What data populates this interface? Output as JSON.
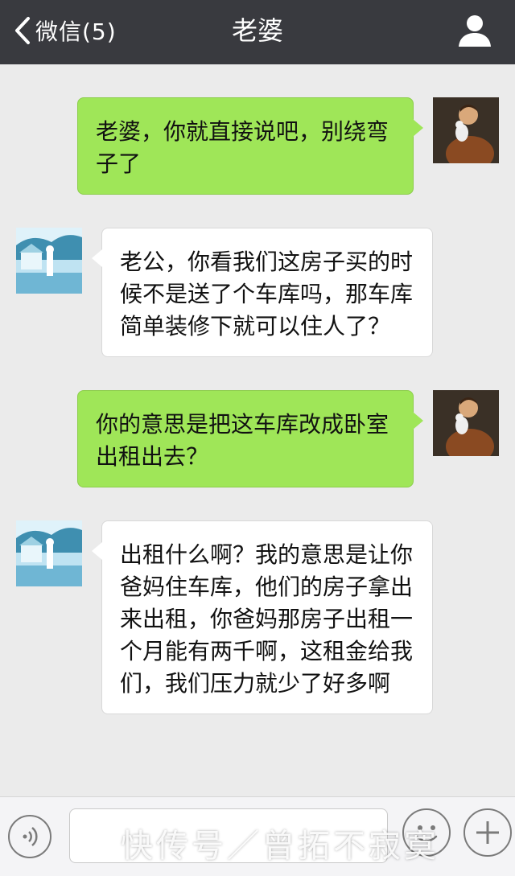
{
  "header": {
    "back_label": "微信(5)",
    "title": "老婆"
  },
  "messages": [
    {
      "sender": "me",
      "text": "老婆，你就直接说吧，别绕弯子了"
    },
    {
      "sender": "other",
      "text": "老公，你看我们这房子买的时候不是送了个车库吗，那车库简单装修下就可以住人了？"
    },
    {
      "sender": "me",
      "text": "你的意思是把这车库改成卧室出租出去？"
    },
    {
      "sender": "other",
      "text": "出租什么啊？我的意思是让你爸妈住车库，他们的房子拿出来出租，你爸妈那房子出租一个月能有两千啊，这租金给我们，我们压力就少了好多啊"
    }
  ],
  "input_bar": {
    "text_value": "",
    "watermark": "快传号／曾拓不寂寞"
  },
  "colors": {
    "header_bg": "#393a3f",
    "chat_bg": "#ebebeb",
    "my_bubble": "#9fe658",
    "their_bubble": "#ffffff"
  },
  "icons": [
    "chevron-left-icon",
    "user-profile-icon",
    "voice-icon",
    "emoji-icon",
    "plus-icon"
  ]
}
